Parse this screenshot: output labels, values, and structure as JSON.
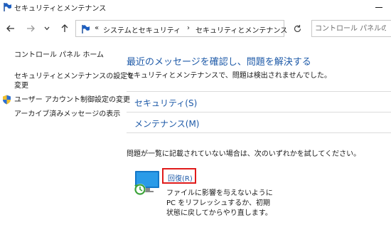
{
  "window": {
    "title": "セキュリティとメンテナンス"
  },
  "nav": {
    "crumb_separator": "«",
    "breadcrumb": [
      {
        "label": "システムとセキュリティ"
      },
      {
        "label": "セキュリティとメンテナンス"
      }
    ],
    "arrow": "›",
    "search_placeholder": "コントロール パネルの検"
  },
  "sidebar": {
    "links": [
      {
        "label": "コントロール パネル ホーム"
      },
      {
        "label": "セキュリティとメンテナンスの設定を"
      },
      {
        "label": "変更"
      },
      {
        "label": "ユーザー アカウント制御設定の変更"
      },
      {
        "label": "アーカイブ済みメッセージの表示"
      }
    ]
  },
  "main": {
    "heading": "最近のメッセージを確認し、問題を解決する",
    "subtext": "セキュリティとメンテナンスで、問題は検出されませんでした。",
    "sections": [
      {
        "label": "セキュリティ(S)"
      },
      {
        "label": "メンテナンス(M)"
      }
    ],
    "hint": "問題が一覧に記載されていない場合は、次のいずれかを試してください。",
    "recovery": {
      "label": "回復(R)",
      "description_lines": [
        "ファイルに影響を与えないように",
        "PC をリフレッシュするか、初期",
        "状態に戻してからやり直します。"
      ]
    }
  },
  "colors": {
    "link_blue": "#1e5aa8",
    "highlight_red": "#e01b1b"
  }
}
